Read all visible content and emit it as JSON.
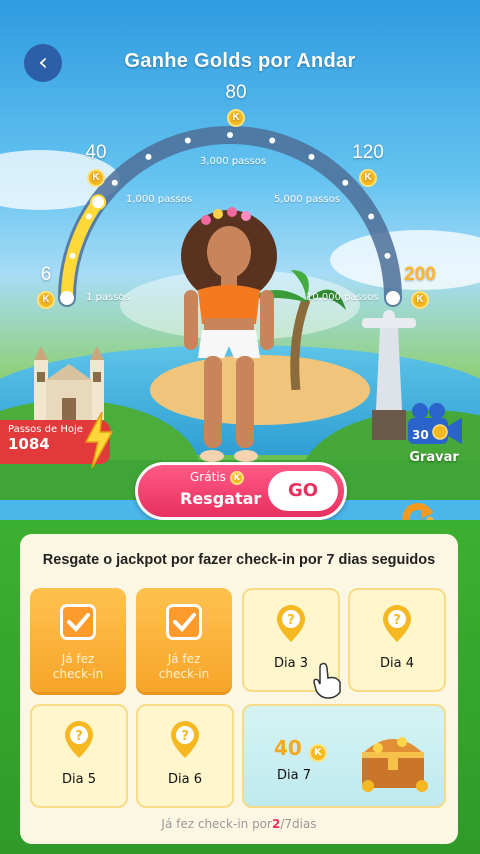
{
  "header": {
    "title": "Ganhe Golds por Andar"
  },
  "progress": {
    "milestones": [
      {
        "reward": "6",
        "steps": "1 passos"
      },
      {
        "reward": "40",
        "steps": "1,000 passos"
      },
      {
        "reward": "80",
        "steps": "3,000 passos"
      },
      {
        "reward": "120",
        "steps": "5,000 passos"
      },
      {
        "reward": "200",
        "steps": "10,000 passos"
      }
    ],
    "reached_fraction": 0.2,
    "coin_letter": "K"
  },
  "today": {
    "label": "Passos de Hoje",
    "value": "1084"
  },
  "record": {
    "count": "30",
    "label": "Gravar"
  },
  "claim": {
    "free_label": "Grátis",
    "redeem_label": "Resgatar",
    "go_label": "GO"
  },
  "checkin": {
    "title": "Resgate o jackpot por fazer check-in por 7 dias seguidos",
    "days": [
      {
        "label": "Já fez check-in",
        "state": "done"
      },
      {
        "label": "Já fez check-in",
        "state": "done"
      },
      {
        "label": "Dia 3",
        "state": "todo"
      },
      {
        "label": "Dia 4",
        "state": "todo"
      },
      {
        "label": "Dia 5",
        "state": "todo"
      },
      {
        "label": "Dia 6",
        "state": "todo"
      },
      {
        "label": "Dia 7",
        "state": "jackpot",
        "reward": "40"
      }
    ],
    "footer_prefix": "Já fez check-in por",
    "footer_count": "2",
    "footer_suffix": "/7dias"
  },
  "colors": {
    "accent": "#e8305f",
    "gold": "#f6b820",
    "today_red": "#e23a3a"
  }
}
